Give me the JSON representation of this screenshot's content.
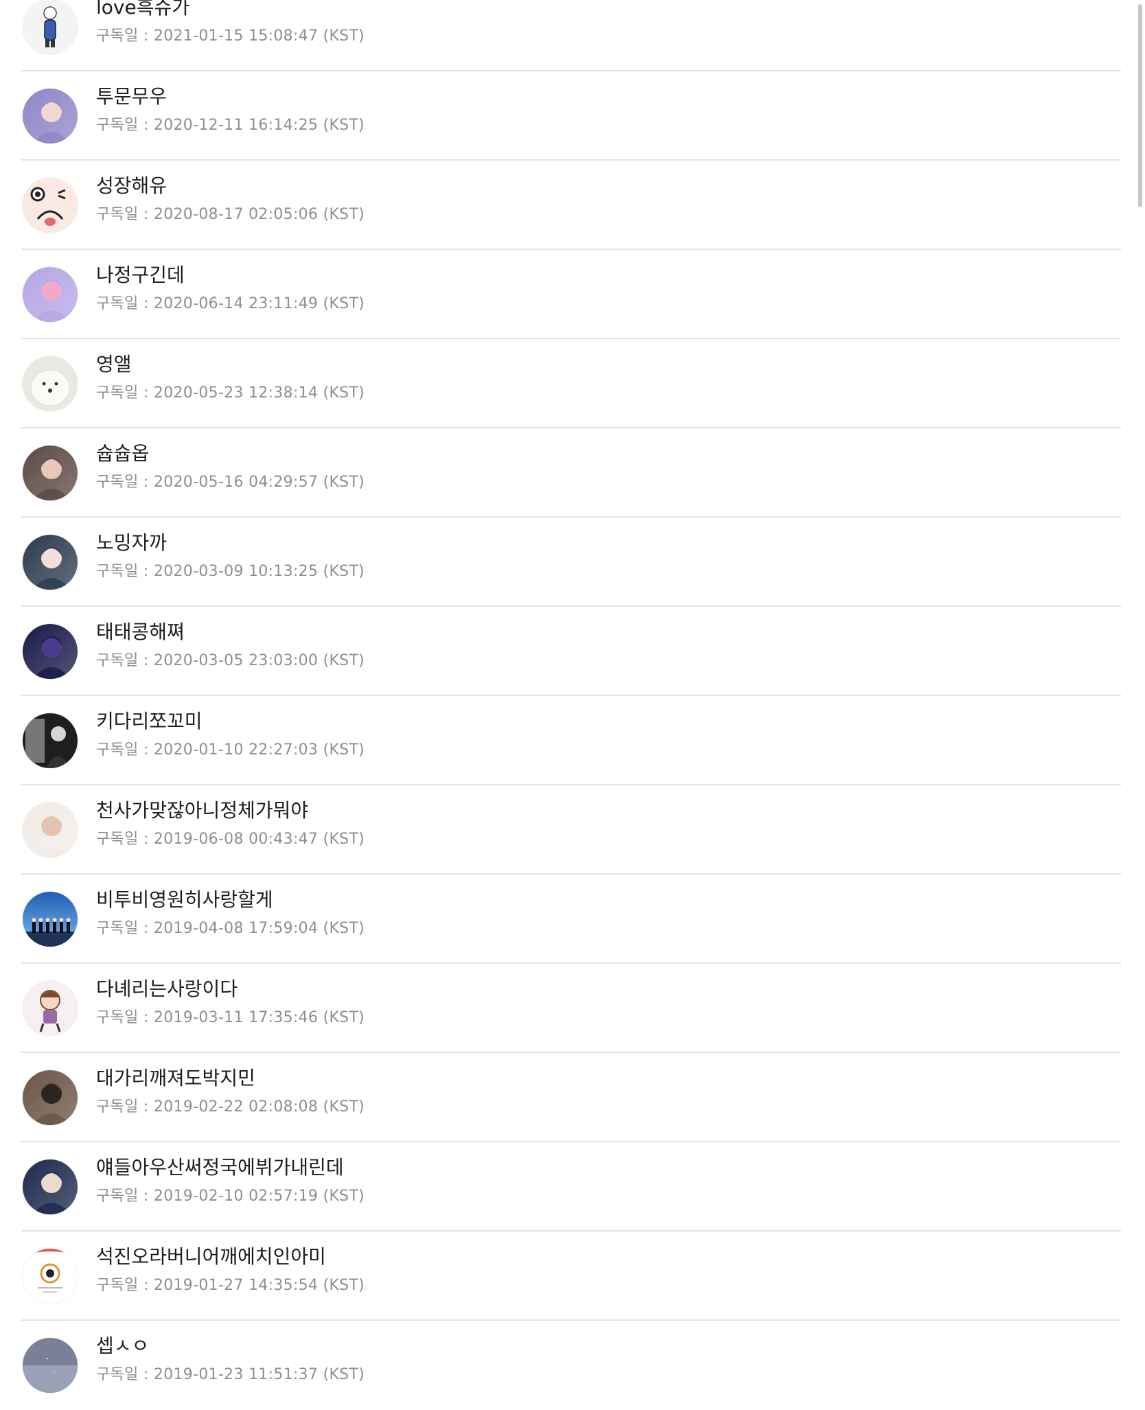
{
  "subscribers": [
    {
      "name": "love흑슈가",
      "date": "구독일 : 2021-01-15 15:08:47 (KST)",
      "avatar": "cartoon-figure",
      "colors": [
        "#f4f4f4",
        "#3b5bb5"
      ]
    },
    {
      "name": "투문무우",
      "date": "구독일 : 2020-12-11 16:14:25 (KST)",
      "avatar": "purple-hair-person",
      "colors": [
        "#8e86c9",
        "#f0d9d2"
      ]
    },
    {
      "name": "성장해유",
      "date": "구독일 : 2020-08-17 02:05:06 (KST)",
      "avatar": "cartoon-face",
      "colors": [
        "#fbe9e4",
        "#222222"
      ]
    },
    {
      "name": "나정구긴데",
      "date": "구독일 : 2020-06-14 23:11:49 (KST)",
      "avatar": "pink-jacket-person",
      "colors": [
        "#b6a6e6",
        "#f2a9c8"
      ]
    },
    {
      "name": "영앨",
      "date": "구독일 : 2020-05-23 12:38:14 (KST)",
      "avatar": "white-dog",
      "colors": [
        "#e9e9e4",
        "#fafaf7"
      ]
    },
    {
      "name": "슙슙옵",
      "date": "구독일 : 2020-05-16 04:29:57 (KST)",
      "avatar": "dark-hair-person",
      "colors": [
        "#5d4a45",
        "#e8c8bc"
      ]
    },
    {
      "name": "노밍자까",
      "date": "구독일 : 2020-03-09 10:13:25 (KST)",
      "avatar": "flower-crown-person",
      "colors": [
        "#2d3d4f",
        "#f3ded8"
      ]
    },
    {
      "name": "태태콩해쪄",
      "date": "구독일 : 2020-03-05 23:03:00 (KST)",
      "avatar": "night-blue-person",
      "colors": [
        "#1a1a4a",
        "#4a3c8c"
      ]
    },
    {
      "name": "키다리쪼꼬미",
      "date": "구독일 : 2020-01-10 22:27:03 (KST)",
      "avatar": "black-white-photo",
      "colors": [
        "#1e1e1e",
        "#d6d6d6"
      ]
    },
    {
      "name": "천사가맞잖아니정체가뭐야",
      "date": "구독일 : 2019-06-08 00:43:47 (KST)",
      "avatar": "light-photo-person",
      "colors": [
        "#f1ece8",
        "#e3c2b0"
      ]
    },
    {
      "name": "비투비영원히사랑할게",
      "date": "구독일 : 2019-04-08 17:59:04 (KST)",
      "avatar": "stage-group",
      "colors": [
        "#1f5fb4",
        "#7fb7ec"
      ]
    },
    {
      "name": "다녜리는사랑이다",
      "date": "구독일 : 2019-03-11 17:35:46 (KST)",
      "avatar": "cartoon-chibi",
      "colors": [
        "#f6f0f2",
        "#9a6aa6"
      ]
    },
    {
      "name": "대가리깨져도박지민",
      "date": "구독일 : 2019-02-22 02:08:08 (KST)",
      "avatar": "warm-photo-person",
      "colors": [
        "#6b5547",
        "#2b2522"
      ]
    },
    {
      "name": "얘들아우산써정국에뷔가내린데",
      "date": "구독일 : 2019-02-10 02:57:19 (KST)",
      "avatar": "navy-coat-person",
      "colors": [
        "#1d2a4d",
        "#eed9cf"
      ]
    },
    {
      "name": "석진오라버니어깨에치인아미",
      "date": "구독일 : 2019-01-27 14:35:54 (KST)",
      "avatar": "circle-logo",
      "colors": [
        "#ffffff",
        "#e4524a"
      ]
    },
    {
      "name": "셉ㅅㅇ",
      "date": "구독일 : 2019-01-23 11:51:37 (KST)",
      "avatar": "dusk-sky",
      "colors": [
        "#7b8096",
        "#9aa0b5"
      ]
    }
  ]
}
